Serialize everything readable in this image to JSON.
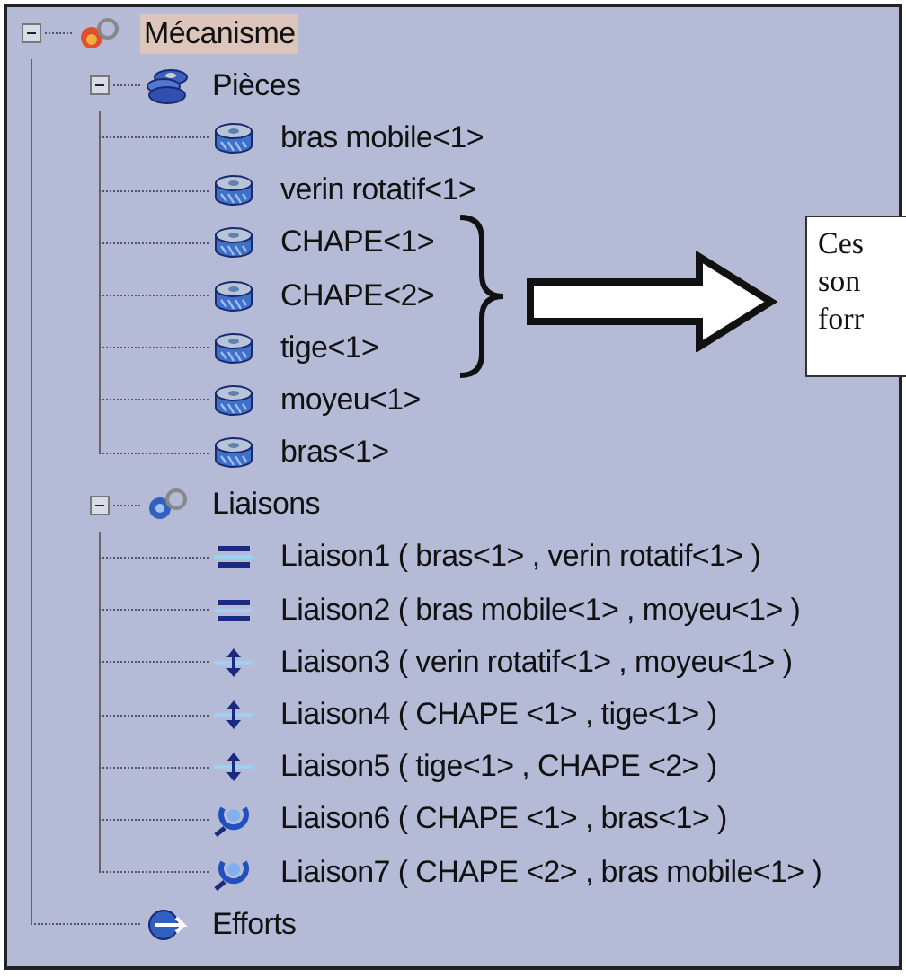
{
  "tree": [
    {
      "label": "Mécanisme",
      "kind": "mechanism",
      "expanded": true,
      "selected": true,
      "children": [
        {
          "label": "Pièces",
          "kind": "parts",
          "expanded": true,
          "selected": false,
          "children": [
            {
              "label": "bras mobile<1>",
              "kind": "part",
              "selected": false
            },
            {
              "label": "verin rotatif<1>",
              "kind": "part",
              "selected": false
            },
            {
              "label": "CHAPE<1>",
              "kind": "part",
              "selected": false
            },
            {
              "label": "CHAPE<2>",
              "kind": "part",
              "selected": false
            },
            {
              "label": "tige<1>",
              "kind": "part",
              "selected": false
            },
            {
              "label": "moyeu<1>",
              "kind": "part",
              "selected": false
            },
            {
              "label": "bras<1>",
              "kind": "part",
              "selected": false
            }
          ]
        },
        {
          "label": "Liaisons",
          "kind": "links",
          "expanded": true,
          "selected": false,
          "children": [
            {
              "label": "Liaison1 ( bras<1> , verin rotatif<1> )",
              "kind": "slide",
              "selected": false
            },
            {
              "label": "Liaison2 ( bras mobile<1> , moyeu<1> )",
              "kind": "slide",
              "selected": false
            },
            {
              "label": "Liaison3 ( verin rotatif<1> , moyeu<1> )",
              "kind": "cylindrical",
              "selected": false
            },
            {
              "label": "Liaison4 ( CHAPE <1> , tige<1> )",
              "kind": "cylindrical",
              "selected": false
            },
            {
              "label": "Liaison5 ( tige<1> , CHAPE <2> )",
              "kind": "cylindrical",
              "selected": false
            },
            {
              "label": "Liaison6 ( CHAPE <1> , bras<1> )",
              "kind": "spherical",
              "selected": false
            },
            {
              "label": "Liaison7 ( CHAPE <2> , bras mobile<1> )",
              "kind": "spherical",
              "selected": false
            }
          ]
        },
        {
          "label": "Efforts",
          "kind": "forces",
          "selected": false
        }
      ]
    }
  ],
  "callout": {
    "lines": [
      "Ces",
      "son",
      "forr"
    ]
  }
}
